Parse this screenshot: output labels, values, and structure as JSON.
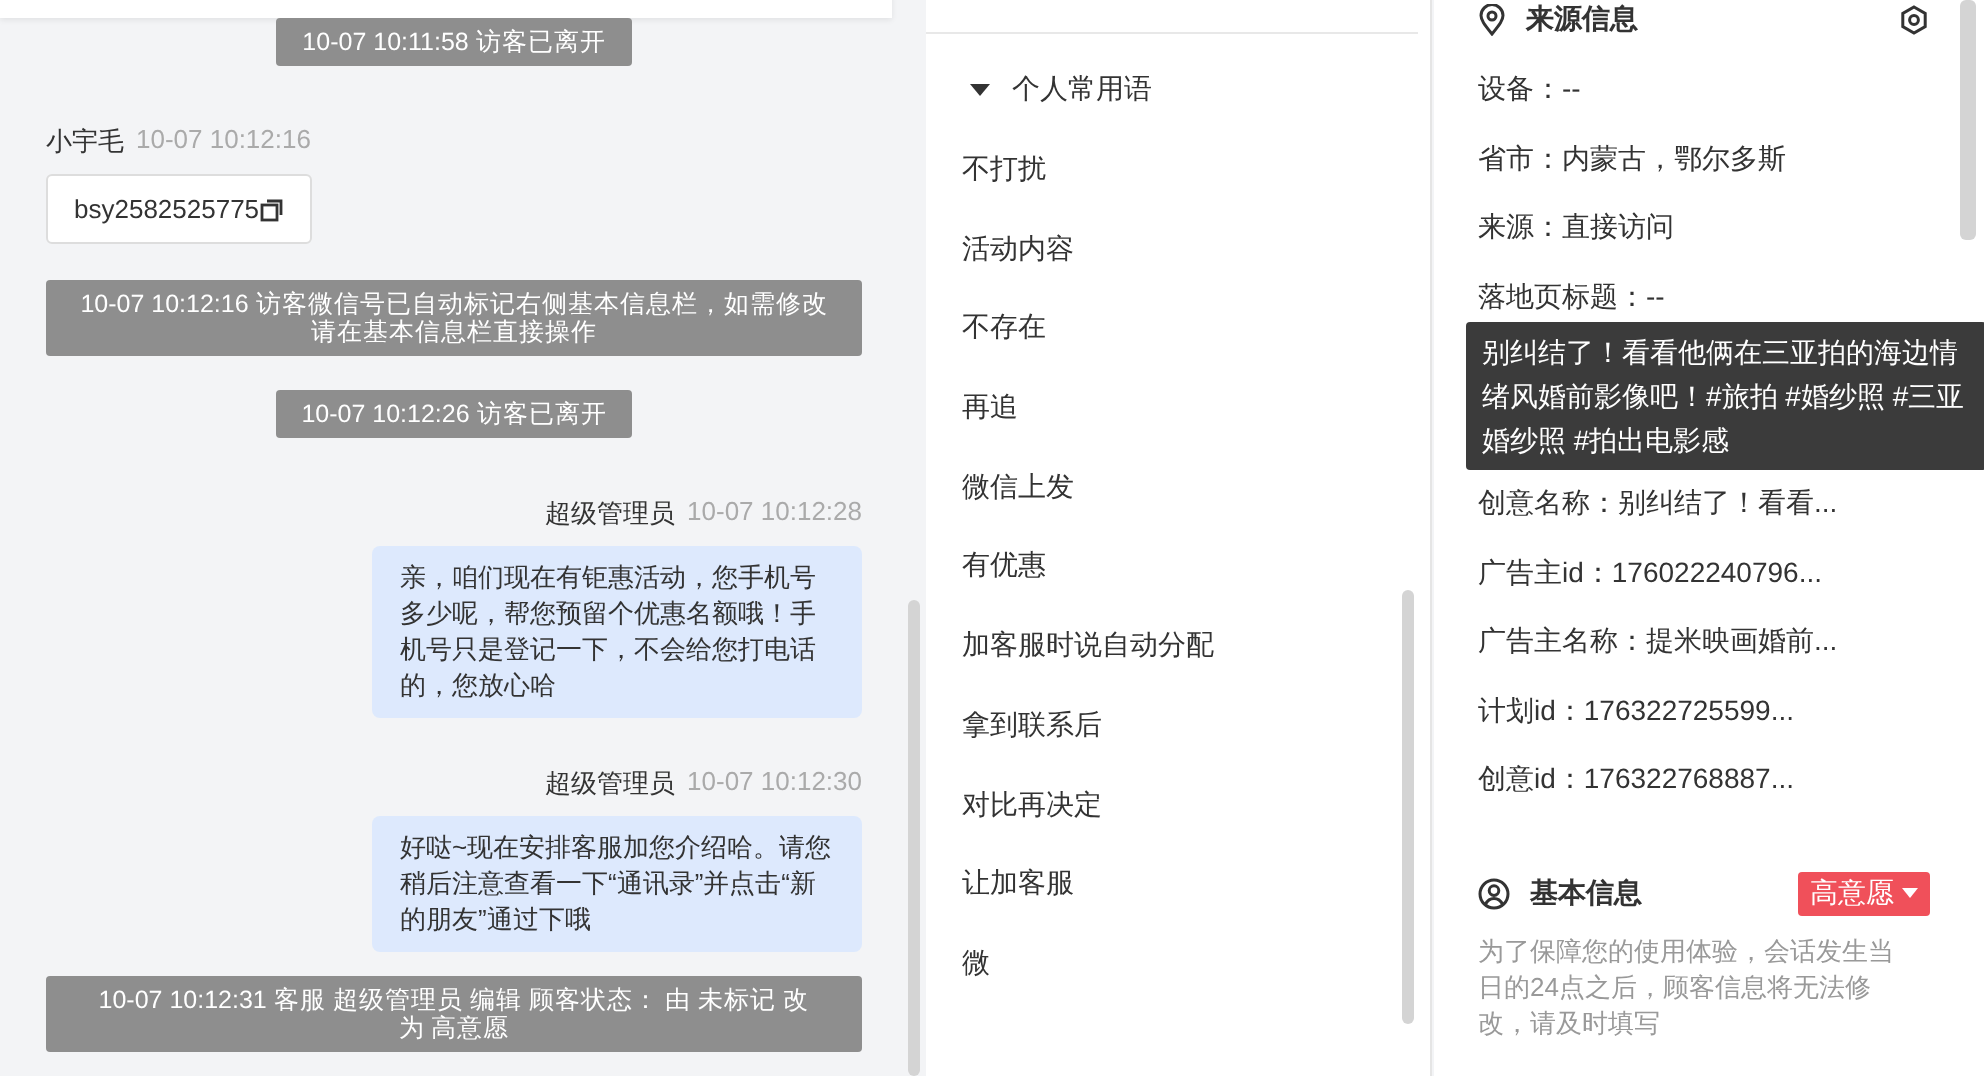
{
  "chat": {
    "messages": [
      {
        "kind": "notice",
        "text": "10-07 10:11:58 访客已离开"
      },
      {
        "kind": "visitor",
        "sender": "小宇毛",
        "time": "10-07 10:12:16",
        "wechat_id": "bsy2582525775"
      },
      {
        "kind": "notice",
        "text": "10-07 10:12:16 访客微信号已自动标记右侧基本信息栏，如需修改请在基本信息栏直接操作"
      },
      {
        "kind": "notice",
        "text": "10-07 10:12:26 访客已离开"
      },
      {
        "kind": "agent",
        "sender": "超级管理员",
        "time": "10-07 10:12:28",
        "text": "亲，咱们现在有钜惠活动，您手机号多少呢，帮您预留个优惠名额哦！手机号只是登记一下，不会给您打电话的，您放心哈"
      },
      {
        "kind": "agent",
        "sender": "超级管理员",
        "time": "10-07 10:12:30",
        "text": "好哒~现在安排客服加您介绍哈。请您稍后注意查看一下“通讯录”并点击“新的朋友”通过下哦"
      },
      {
        "kind": "notice",
        "text": "10-07 10:12:31 客服 超级管理员 编辑 顾客状态： 由 未标记 改为 高意愿"
      }
    ]
  },
  "phrases": {
    "title": "个人常用语",
    "expanded": true,
    "items": [
      "不打扰",
      "活动内容",
      "不存在",
      "再追",
      "微信上发",
      "有优惠",
      "加客服时说自动分配",
      "拿到联系后",
      "对比再决定",
      "让加客服",
      "微"
    ]
  },
  "source_info": {
    "title": "来源信息",
    "rows_above": [
      "设备：--",
      "省市：内蒙古，鄂尔多斯",
      "来源：直接访问",
      "落地页标题：--"
    ],
    "tooltip": "别纠结了！看看他俩在三亚拍的海边情绪风婚前影像吧！#旅拍 #婚纱照 #三亚婚纱照 #拍出电影感",
    "rows_below": [
      "创意名称：别纠结了！看看...",
      "广告主id：176022240796...",
      "广告主名称：提米映画婚前...",
      "计划id：176322725599...",
      "创意id：176322768887..."
    ]
  },
  "basic_info": {
    "title": "基本信息",
    "status": {
      "label": "高意愿",
      "color": "#f0505a"
    },
    "hint": "为了保障您的使用体验，会话发生当日的24点之后，顾客信息将无法修改，请及时填写"
  }
}
